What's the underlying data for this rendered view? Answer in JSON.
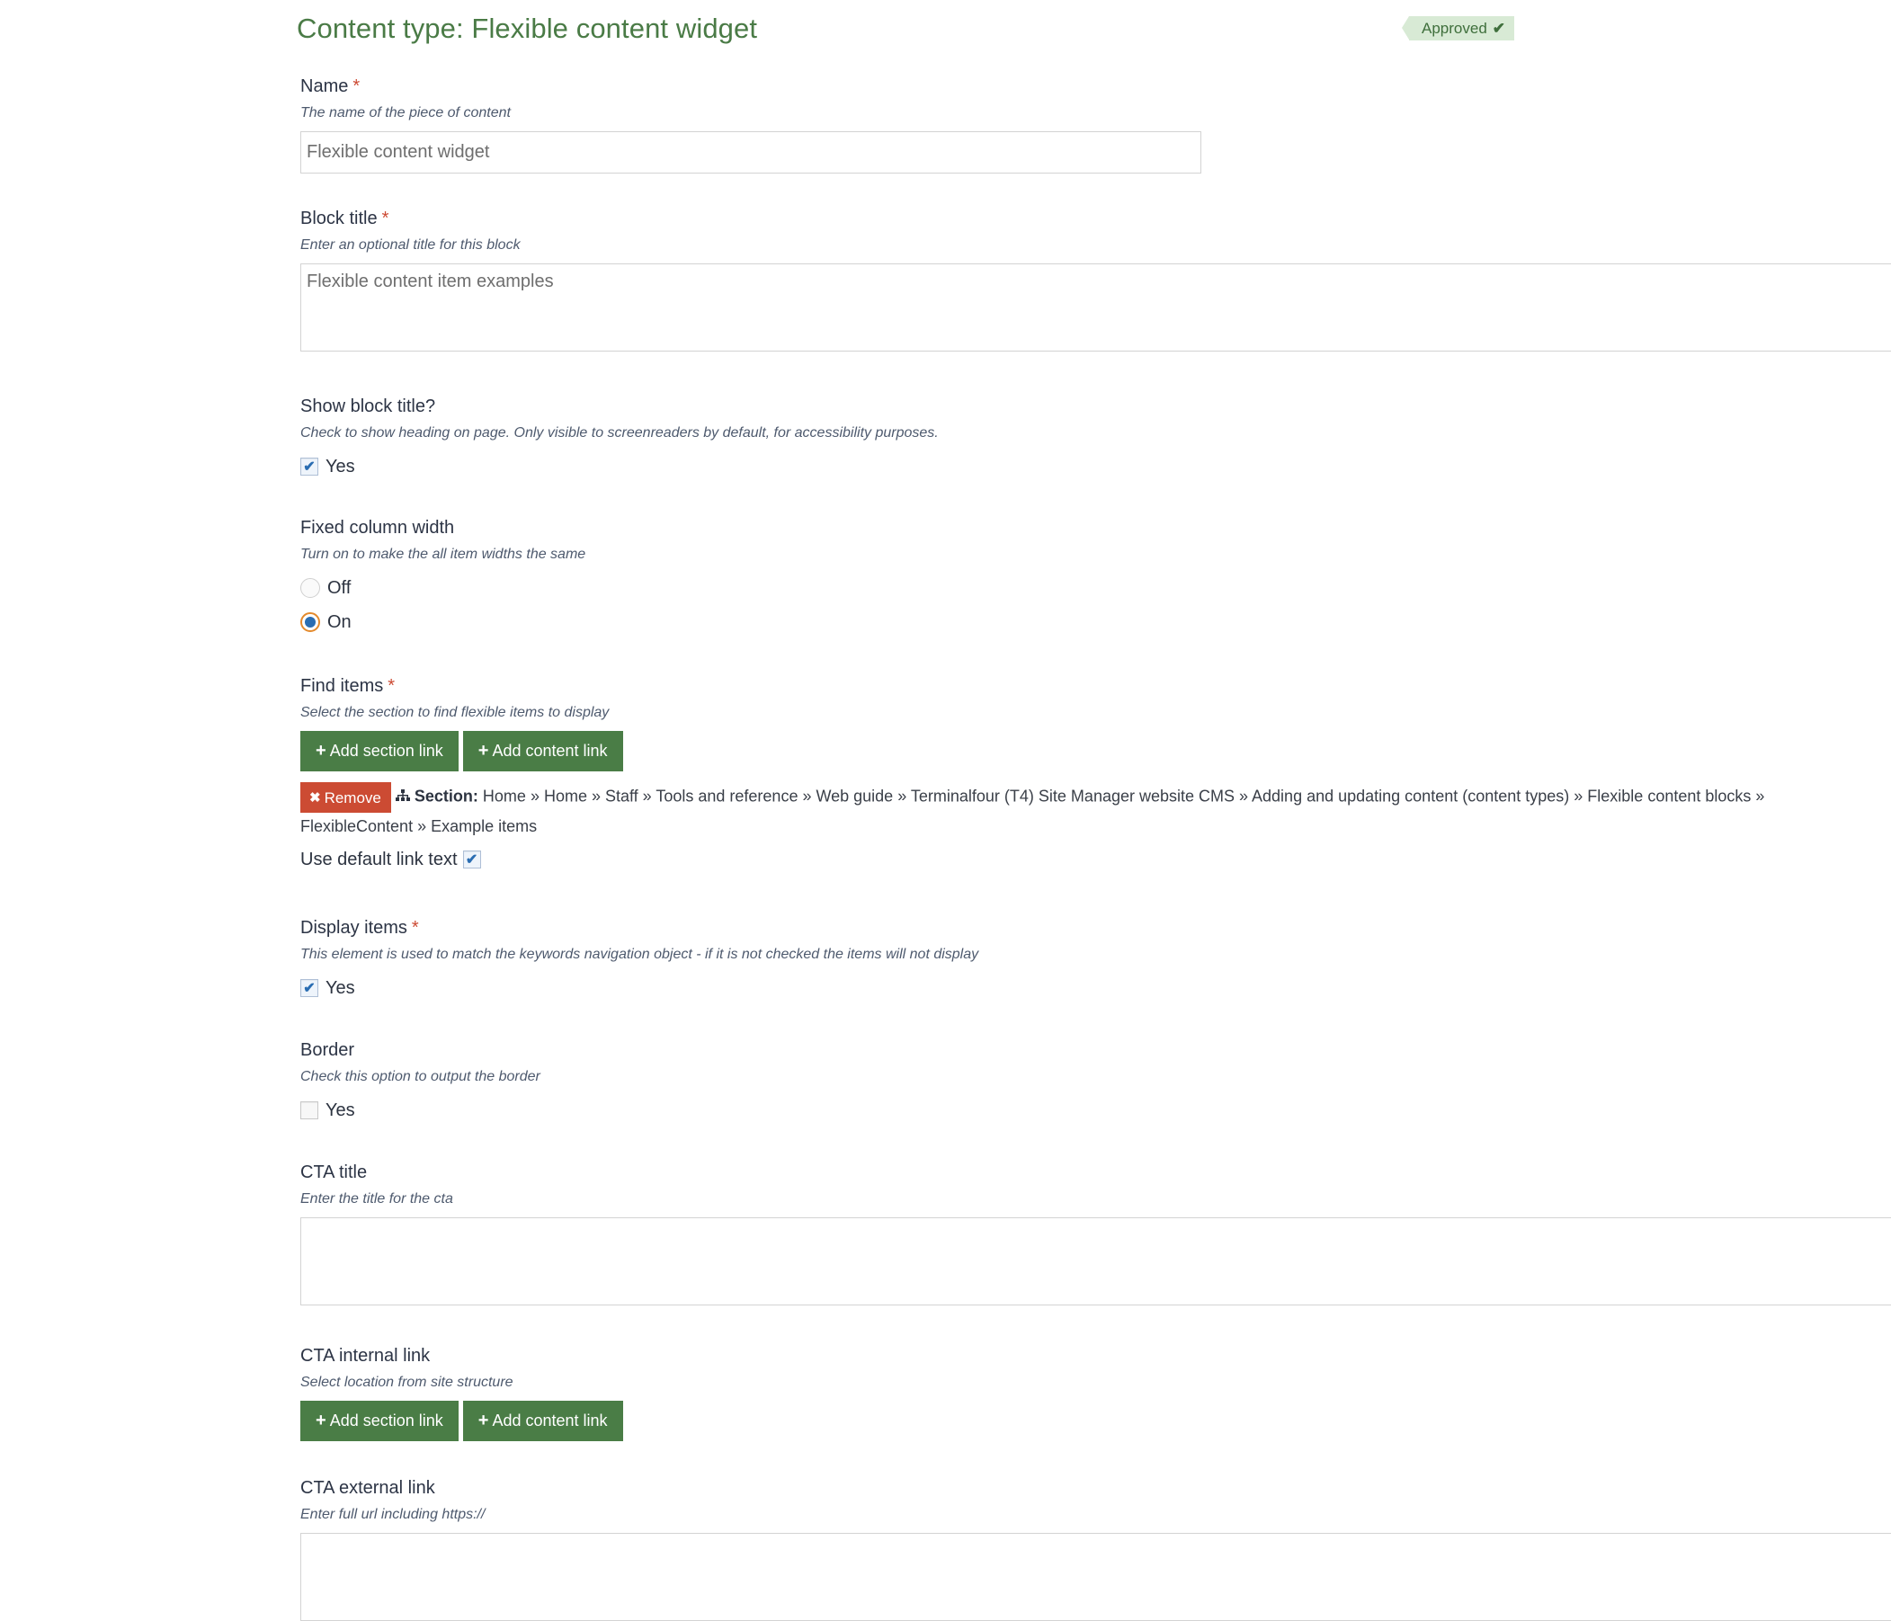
{
  "header": {
    "title": "Content type: Flexible content widget",
    "status": "Approved",
    "status_icon": "check-icon"
  },
  "fields": {
    "name": {
      "label": "Name",
      "required": "*",
      "help": "The name of the piece of content",
      "value": "Flexible content widget"
    },
    "block_title": {
      "label": "Block title",
      "required": "*",
      "help": "Enter an optional title for this block",
      "value": "Flexible content item examples"
    },
    "show_block_title": {
      "label": "Show block title?",
      "help": "Check to show heading on page. Only visible to screenreaders by default, for accessibility purposes.",
      "option_label": "Yes",
      "checked": true
    },
    "fixed_column_width": {
      "label": "Fixed column width",
      "help": "Turn on to make the all item widths the same",
      "options": [
        {
          "label": "Off",
          "selected": false
        },
        {
          "label": "On",
          "selected": true
        }
      ]
    },
    "find_items": {
      "label": "Find items",
      "required": "*",
      "help": "Select the section to find flexible items to display",
      "add_section_label": "Add section link",
      "add_content_label": "Add content link",
      "remove_label": "Remove",
      "section_prefix": "Section:",
      "section_path": "Home » Home » Staff » Tools and reference » Web guide » Terminalfour (T4) Site Manager website CMS » Adding and updating content (content types) » Flexible content blocks » FlexibleContent » Example items",
      "default_link_text_label": "Use default link text",
      "default_link_text_checked": true
    },
    "display_items": {
      "label": "Display items",
      "required": "*",
      "help": "This element is used to match the keywords navigation object - if it is not checked the items will not display",
      "option_label": "Yes",
      "checked": true
    },
    "border": {
      "label": "Border",
      "help": "Check this option to output the border",
      "option_label": "Yes",
      "checked": false
    },
    "cta_title": {
      "label": "CTA title",
      "help": "Enter the title for the cta",
      "value": ""
    },
    "cta_internal_link": {
      "label": "CTA internal link",
      "help": "Select location from site structure",
      "add_section_label": "Add section link",
      "add_content_label": "Add content link"
    },
    "cta_external_link": {
      "label": "CTA external link",
      "help": "Enter full url including https://",
      "value": ""
    }
  },
  "colors": {
    "brand_green": "#4a7d46",
    "danger_red": "#cc4b33",
    "approved_bg": "#d8ead5",
    "checkbox_blue": "#2a6db2",
    "radio_focus_orange": "#e48a2c"
  }
}
